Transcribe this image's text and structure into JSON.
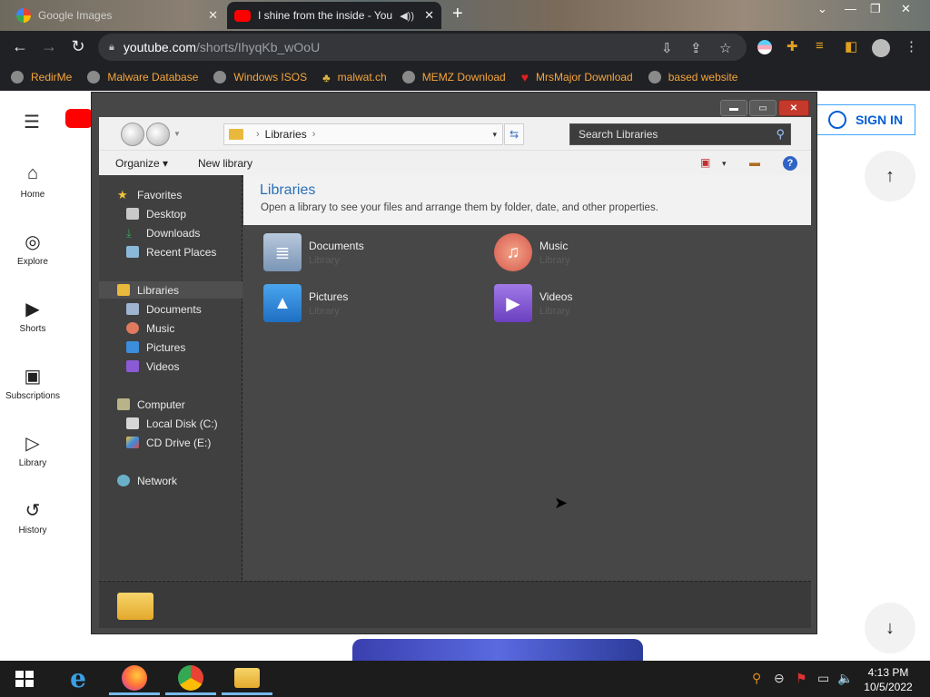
{
  "browser": {
    "tabs": [
      {
        "title": "Google Images",
        "close": "✕"
      },
      {
        "title": "I shine from the inside - You",
        "close": "✕"
      }
    ],
    "new_tab": "+",
    "window_controls": {
      "minimize": "—",
      "restore": "❐",
      "close": "✕",
      "tab_search": "⌄"
    },
    "url_host": "youtube.com",
    "url_path": "/shorts/IhyqKb_wOoU",
    "bookmarks": [
      "RedirMe",
      "Malware Database",
      "Windows ISOS",
      "malwat.ch",
      "MEMZ Download",
      "MrsMajor Download",
      "based website"
    ]
  },
  "youtube": {
    "nav": [
      {
        "label": "Home",
        "icon": "home-icon",
        "glyph": "⌂"
      },
      {
        "label": "Explore",
        "icon": "compass-icon",
        "glyph": "◎"
      },
      {
        "label": "Shorts",
        "icon": "shorts-icon",
        "glyph": "▶"
      },
      {
        "label": "Subscriptions",
        "icon": "subscriptions-icon",
        "glyph": "▣"
      },
      {
        "label": "Library",
        "icon": "library-icon",
        "glyph": "▷"
      },
      {
        "label": "History",
        "icon": "history-icon",
        "glyph": "↺"
      }
    ],
    "sign_in": "SIGN IN",
    "scroll_up": "↑",
    "scroll_down": "↓",
    "menu_glyph": "☰"
  },
  "explorer": {
    "caption_buttons": {
      "minimize": "▬",
      "maximize": "▭",
      "close": "✕"
    },
    "address": {
      "crumb": "Libraries",
      "sep1": "›",
      "sep2": "›",
      "dropdown": "▾",
      "refresh": "⇆"
    },
    "search_placeholder": "Search Libraries",
    "search_glyph": "⚲",
    "commands": {
      "organize": "Organize ▾",
      "new_library": "New library"
    },
    "command_icons": {
      "view": "▣",
      "view_dd": "▾",
      "preview": "▬",
      "help": "?"
    },
    "nav_pane": {
      "favorites": {
        "label": "Favorites",
        "items": [
          "Desktop",
          "Downloads",
          "Recent Places"
        ]
      },
      "libraries": {
        "label": "Libraries",
        "items": [
          "Documents",
          "Music",
          "Pictures",
          "Videos"
        ]
      },
      "computer": {
        "label": "Computer",
        "items": [
          "Local Disk (C:)",
          "CD Drive (E:)"
        ]
      },
      "network": {
        "label": "Network"
      }
    },
    "star_glyph": "★",
    "down_glyph": "⤓",
    "header": {
      "title": "Libraries",
      "description": "Open a library to see your files and arrange them by folder, date, and other properties."
    },
    "libraries": [
      {
        "name": "Documents",
        "type": "Library",
        "glyph": "≣"
      },
      {
        "name": "Music",
        "type": "Library",
        "glyph": "♫"
      },
      {
        "name": "Pictures",
        "type": "Library",
        "glyph": "▲"
      },
      {
        "name": "Videos",
        "type": "Library",
        "glyph": "▶"
      }
    ]
  },
  "taskbar": {
    "ie_glyph": "e",
    "tray": {
      "search": "⚲",
      "minus": "⊖",
      "flag": "⚑",
      "network": "▭",
      "volume": "🔈"
    },
    "clock": {
      "time": "4:13 PM",
      "date": "10/5/2022"
    }
  },
  "colors": {
    "accent": "#2a6fb5",
    "youtube_red": "#ff0000",
    "bookmark_text": "#f6a53d"
  }
}
